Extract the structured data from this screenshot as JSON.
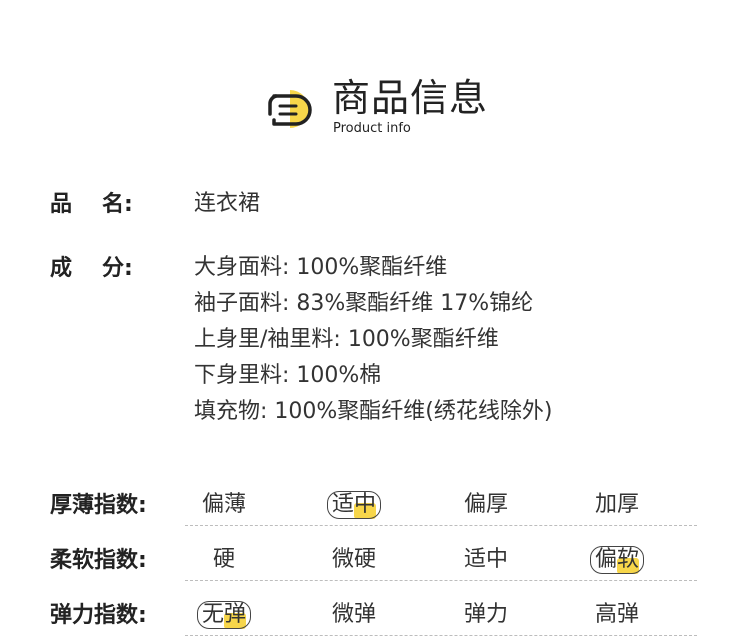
{
  "header": {
    "title_cn": "商品信息",
    "title_en": "Product info",
    "logo_icon": "document-speech-icon",
    "accent_color": "#f7d64a"
  },
  "product_name": {
    "label_a": "品",
    "label_b": "名:",
    "value": "连衣裙"
  },
  "composition": {
    "label_a": "成",
    "label_b": "分:",
    "lines": [
      "大身面料: 100%聚酯纤维",
      "袖子面料: 83%聚酯纤维 17%锦纶",
      "上身里/袖里料: 100%聚酯纤维",
      "下身里料: 100%棉",
      "填充物: 100%聚酯纤维(绣花线除外)"
    ]
  },
  "indices": [
    {
      "label": "厚薄指数:",
      "options": [
        "偏薄",
        "适中",
        "偏厚",
        "加厚"
      ],
      "selected": 1
    },
    {
      "label": "柔软指数:",
      "options": [
        "硬",
        "微硬",
        "适中",
        "偏软"
      ],
      "selected": 3
    },
    {
      "label": "弹力指数:",
      "options": [
        "无弹",
        "微弹",
        "弹力",
        "高弹"
      ],
      "selected": 0
    }
  ]
}
